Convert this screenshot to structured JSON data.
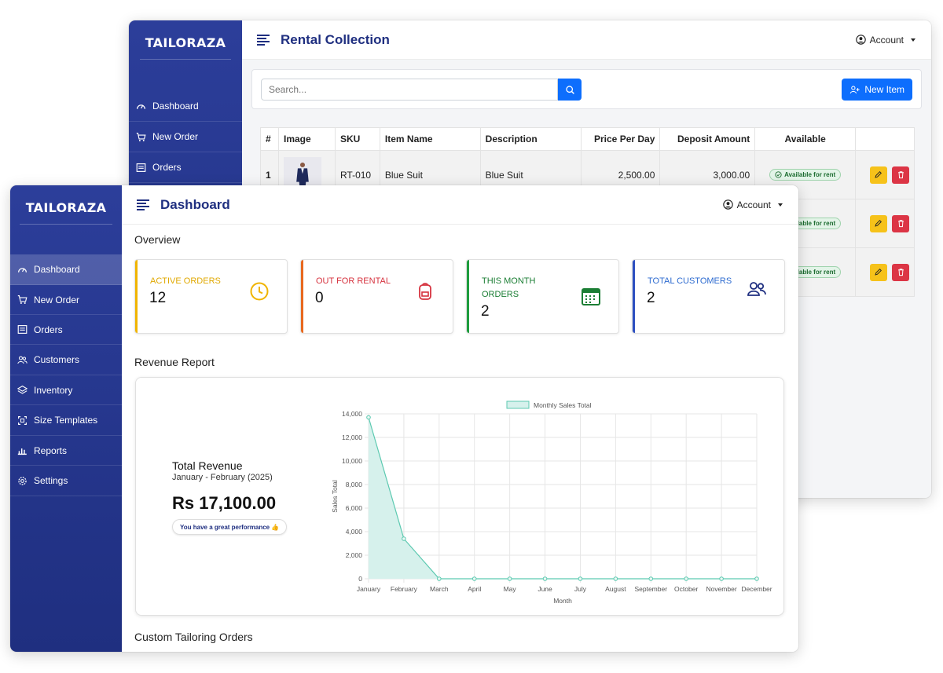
{
  "rental_window": {
    "brand": "TAILORAZA",
    "page_title": "Rental Collection",
    "account_label": "Account",
    "sidebar": [
      {
        "label": "Dashboard",
        "icon": "gauge-icon"
      },
      {
        "label": "New Order",
        "icon": "cart-icon"
      },
      {
        "label": "Orders",
        "icon": "list-icon"
      }
    ],
    "search_placeholder": "Search...",
    "new_item_label": "New Item",
    "table": {
      "headers": [
        "#",
        "Image",
        "SKU",
        "Item Name",
        "Description",
        "Price Per Day",
        "Deposit Amount",
        "Available",
        ""
      ],
      "rows": [
        {
          "num": "1",
          "sku": "RT-010",
          "name": "Blue Suit",
          "description": "Blue Suit",
          "price": "2,500.00",
          "deposit": "3,000.00",
          "available": "Available for rent"
        },
        {
          "num": "",
          "sku": "",
          "name": "",
          "description": "",
          "price": "",
          "deposit": "",
          "available": "Available for rent"
        },
        {
          "num": "",
          "sku": "",
          "name": "",
          "description": "",
          "price": "",
          "deposit": "",
          "available": "Available for rent"
        }
      ]
    }
  },
  "dashboard_window": {
    "brand": "TAILORAZA",
    "page_title": "Dashboard",
    "account_label": "Account",
    "sidebar": [
      {
        "label": "Dashboard",
        "icon": "gauge-icon",
        "active": true
      },
      {
        "label": "New Order",
        "icon": "cart-icon"
      },
      {
        "label": "Orders",
        "icon": "list-icon"
      },
      {
        "label": "Customers",
        "icon": "users-icon"
      },
      {
        "label": "Inventory",
        "icon": "layers-icon"
      },
      {
        "label": "Size Templates",
        "icon": "resize-icon"
      },
      {
        "label": "Reports",
        "icon": "bar-chart-icon"
      },
      {
        "label": "Settings",
        "icon": "gear-icon"
      }
    ],
    "overview_title": "Overview",
    "stats": [
      {
        "label": "ACTIVE ORDERS",
        "value": "12",
        "color": "#f0b400",
        "icon": "clock-icon"
      },
      {
        "label": "OUT FOR RENTAL",
        "value": "0",
        "color": "#e8681e",
        "icon": "backpack-icon"
      },
      {
        "label": "THIS MONTH ORDERS",
        "value": "2",
        "color": "#1e9c3d",
        "icon": "calendar-icon"
      },
      {
        "label": "TOTAL CUSTOMERS",
        "value": "2",
        "color": "#2c4fc0",
        "icon": "people-icon"
      }
    ],
    "revenue_section_title": "Revenue Report",
    "revenue": {
      "title": "Total Revenue",
      "period": "January - February (2025)",
      "amount": "Rs 17,100.00",
      "badge": "You have a great performance 👍"
    },
    "custom_orders_title": "Custom Tailoring Orders"
  },
  "chart_data": {
    "type": "area",
    "categories": [
      "January",
      "February",
      "March",
      "April",
      "May",
      "June",
      "July",
      "August",
      "September",
      "October",
      "November",
      "December"
    ],
    "series": [
      {
        "name": "Monthly Sales Total",
        "values": [
          13700,
          3400,
          0,
          0,
          0,
          0,
          0,
          0,
          0,
          0,
          0,
          0
        ]
      }
    ],
    "xlabel": "Month",
    "ylabel": "Sales Total",
    "ylim": [
      0,
      14000
    ],
    "yticks": [
      "0",
      "2,000",
      "4,000",
      "6,000",
      "8,000",
      "10,000",
      "12,000",
      "14,000"
    ],
    "grid": true,
    "legend": "top",
    "line_color": "#5cc9b0",
    "fill_color": "#d6f1ec"
  }
}
